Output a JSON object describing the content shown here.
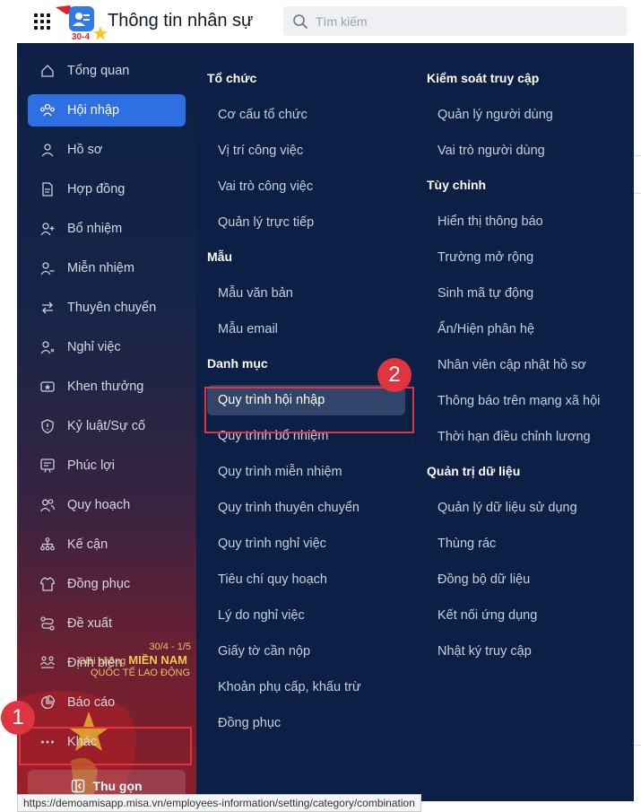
{
  "header": {
    "app_title": "Thông tin nhân sự",
    "logo_badge": "30-4",
    "search_placeholder": "Tìm kiếm"
  },
  "sidebar": {
    "items": [
      {
        "label": "Tổng quan",
        "icon": "dashboard-icon",
        "active": false
      },
      {
        "label": "Hội nhập",
        "icon": "people-onboard-icon",
        "active": true
      },
      {
        "label": "Hồ sơ",
        "icon": "person-icon",
        "active": false
      },
      {
        "label": "Hợp đồng",
        "icon": "document-icon",
        "active": false
      },
      {
        "label": "Bổ nhiệm",
        "icon": "person-add-icon",
        "active": false
      },
      {
        "label": "Miễn nhiệm",
        "icon": "person-remove-icon",
        "active": false
      },
      {
        "label": "Thuyên chuyển",
        "icon": "transfer-arrows-icon",
        "active": false
      },
      {
        "label": "Nghỉ việc",
        "icon": "person-leave-icon",
        "active": false
      },
      {
        "label": "Khen thưởng",
        "icon": "award-icon",
        "active": false
      },
      {
        "label": "Kỷ luật/Sự cố",
        "icon": "shield-warning-icon",
        "active": false
      },
      {
        "label": "Phúc lợi",
        "icon": "benefit-icon",
        "active": false
      },
      {
        "label": "Quy hoạch",
        "icon": "people-plan-icon",
        "active": false
      },
      {
        "label": "Kế cận",
        "icon": "hierarchy-icon",
        "active": false
      },
      {
        "label": "Đồng phục",
        "icon": "shirt-icon",
        "active": false
      },
      {
        "label": "Đề xuất",
        "icon": "proposal-icon",
        "active": false
      },
      {
        "label": "Định biên",
        "icon": "headcount-icon",
        "active": false
      },
      {
        "label": "Báo cáo",
        "icon": "pie-chart-icon",
        "active": false
      },
      {
        "label": "Khác",
        "icon": "more-dots-icon",
        "active": false
      }
    ],
    "collapse_label": "Thu gọn",
    "banner": {
      "date": "30/4 - 1/5",
      "line1": "Giải phóng",
      "line1_big": "MIỀN NAM",
      "line2": "QUỐC TẾ LAO ĐỘNG"
    }
  },
  "menu": {
    "columns": [
      {
        "groups": [
          {
            "heading": "Tổ chức",
            "items": [
              "Cơ cấu tổ chức",
              "Vị trí công việc",
              "Vai trò công việc",
              "Quản lý trực tiếp"
            ]
          },
          {
            "heading": "Mẫu",
            "items": [
              "Mẫu văn bản",
              "Mẫu email"
            ]
          },
          {
            "heading": "Danh mục",
            "items": [
              "Quy trình hội nhập",
              "Quy trình bổ nhiệm",
              "Quy trình miễn nhiệm",
              "Quy trình thuyên chuyển",
              "Quy trình nghỉ việc",
              "Tiêu chí quy hoạch",
              "Lý do nghỉ việc",
              "Giấy tờ cần nộp",
              "Khoản phụ cấp, khấu trừ",
              "Đồng phục"
            ]
          }
        ]
      },
      {
        "groups": [
          {
            "heading": "Kiểm soát truy cập",
            "items": [
              "Quản lý người dùng",
              "Vai trò người dùng"
            ]
          },
          {
            "heading": "Tùy chỉnh",
            "items": [
              "Hiển thị thông báo",
              "Trường mở rộng",
              "Sinh mã tự động",
              "Ẩn/Hiện phân hệ",
              "Nhân viên cập nhật hồ sơ",
              "Thông báo trên mạng xã hội",
              "Thời hạn điều chỉnh lương"
            ]
          },
          {
            "heading": "Quản trị dữ liệu",
            "items": [
              "Quản lý dữ liệu sử dụng",
              "Thùng rác",
              "Đồng bộ dữ liệu",
              "Kết nối ứng dụng",
              "Nhật ký truy cập"
            ]
          }
        ]
      }
    ],
    "active_item": "Quy trình hội nhập"
  },
  "annotations": {
    "step1": "1",
    "step2": "2"
  },
  "status_bar": {
    "url": "https://demoamisapp.misa.vn/employees-information/setting/category/combination"
  },
  "colors": {
    "sidebar_active": "#2f6fe4",
    "menu_bg": "#0c1f45",
    "highlight": "#e0353e"
  }
}
